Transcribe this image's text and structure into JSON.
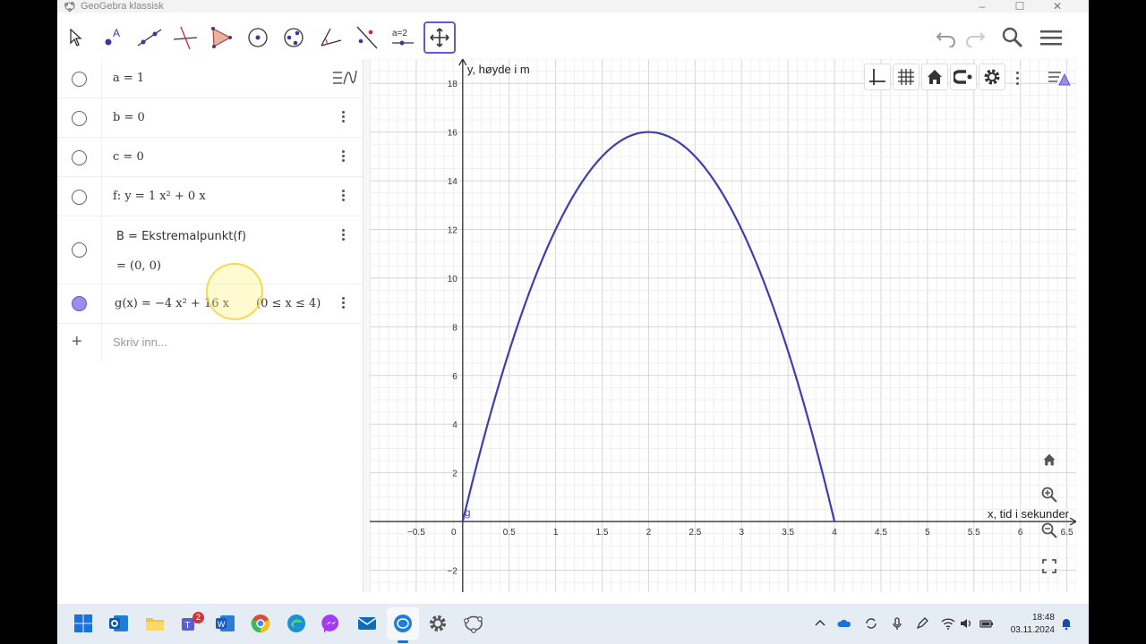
{
  "window": {
    "title": "GeoGebra klassisk"
  },
  "algebra": {
    "rows": [
      {
        "text": "a = 1",
        "selected": false
      },
      {
        "text": "b = 0",
        "selected": false
      },
      {
        "text": "c = 0",
        "selected": false
      },
      {
        "text": "f: y = 1 x² + 0 x",
        "selected": false
      },
      {
        "text": "B = Ekstremalpunkt(f)",
        "result": "= (0, 0)",
        "selected": false
      },
      {
        "text": "g(x) = −4 x² + 16 x",
        "condition": "(0 ≤ x ≤ 4)",
        "selected": true
      }
    ],
    "input_placeholder": "Skriv inn..."
  },
  "graphics": {
    "x_axis_label": "x, tid i sekunder",
    "y_axis_label": "y, høyde i m",
    "function_label": "g",
    "curve_color": "#3f3fab",
    "x_ticks": [
      "−0.5",
      "0",
      "0.5",
      "1",
      "1.5",
      "2",
      "2.5",
      "3",
      "3.5",
      "4",
      "4.5",
      "5",
      "5.5",
      "6",
      "6.5"
    ],
    "y_ticks": [
      "18",
      "16",
      "14",
      "12",
      "10",
      "8",
      "6",
      "4",
      "2",
      "−2"
    ]
  },
  "chart_data": {
    "type": "line",
    "series": [
      {
        "name": "g",
        "expression": "-4x^2+16x",
        "domain": [
          0,
          4
        ]
      }
    ],
    "xlabel": "x, tid i sekunder",
    "ylabel": "y, høyde i m",
    "xlim": [
      -1,
      6.6
    ],
    "ylim": [
      -2.9,
      19
    ],
    "x_ticks": [
      -0.5,
      0,
      0.5,
      1,
      1.5,
      2,
      2.5,
      3,
      3.5,
      4,
      4.5,
      5,
      5.5,
      6,
      6.5
    ],
    "y_ticks": [
      -2,
      2,
      4,
      6,
      8,
      10,
      12,
      14,
      16,
      18
    ],
    "grid": true
  },
  "taskbar": {
    "time": "18:48",
    "date": "03.11.2024",
    "teams_badge": "2"
  }
}
